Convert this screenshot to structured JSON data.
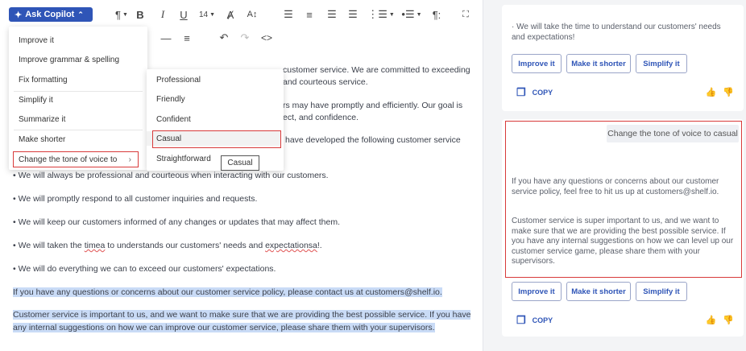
{
  "toolbar": {
    "copilot_label": "Ask Copilot",
    "font_size": "14",
    "paragraph_glyph": "¶"
  },
  "menu": {
    "items": [
      "Improve it",
      "Improve grammar & spelling",
      "Fix formatting",
      "Simplify it",
      "Summarize it",
      "Make shorter",
      "Change the tone of voice to"
    ],
    "tones": [
      "Professional",
      "Friendly",
      "Confident",
      "Casual",
      "Straightforward"
    ],
    "tooltip": "Casual"
  },
  "document": {
    "l1": "customer service. We are committed to exceeding",
    "l2": "and courteous service.",
    "l3": "rs may have promptly and efficiently. Our goal is",
    "l4": "ect, and confidence.",
    "l5": "have developed the following customer service",
    "l6": "• We will always be professional and courteous when interacting with our customers.",
    "l7": "• We will promptly respond to all customer inquiries and requests.",
    "l8": "• We will keep our customers informed of any changes or updates that may affect them.",
    "l9a": "• We will taken the ",
    "l9b": "timea",
    "l9c": " to understands our customers' needs and ",
    "l9d": "expectationsa",
    "l9e": "!.",
    "l10": "• We will do everything we can to exceed our customers' expectations.",
    "l11": "If you have any questions or concerns about our customer service policy, please contact us at customers@shelf.io.",
    "l12": "Customer service is important to us, and we want to make sure that we are providing the best possible service. If you have",
    "l13": "any internal suggestions on how we can improve our customer service, please share them with your supervisors."
  },
  "panel": {
    "card1_text": "· We will take the time to understand our customers' needs and expectations!",
    "chips": [
      "Improve it",
      "Make it shorter",
      "Simplify it"
    ],
    "copy_label": "COPY",
    "user_prompt": "Change the tone of voice to casual",
    "reply_p1": "If you have any questions or concerns about our customer service policy, feel free to hit us up at customers@shelf.io.",
    "reply_p2": "Customer service is super important to us, and we want to make sure that we are providing the best possible service. If you have any internal suggestions on how we can level up our customer service game, please share them with your supervisors."
  },
  "colors": {
    "accent": "#2f55b7",
    "highlight": "#c9dbf6",
    "frame": "#d83a3a"
  }
}
